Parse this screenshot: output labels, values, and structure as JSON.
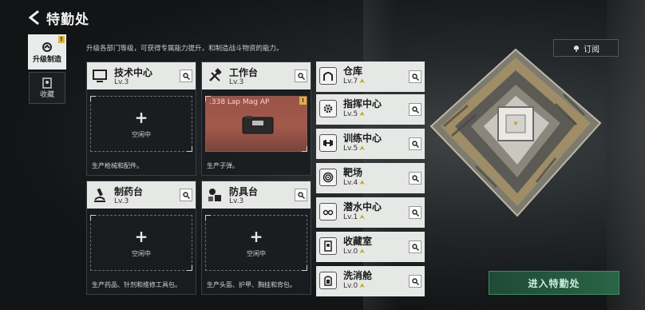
{
  "header": {
    "title": "特勤处",
    "description": "升级各部门等级，可获得专属能力提升，和制造战斗物资的能力。",
    "subscribe_label": "订阅"
  },
  "tabs": [
    {
      "label": "升级制造",
      "badge": "!"
    },
    {
      "label": "收藏"
    }
  ],
  "cards": [
    {
      "name": "技术中心",
      "level": "Lv.3",
      "slot_label": "空闲中",
      "footer": "生产枪械和配件。"
    },
    {
      "name": "工作台",
      "level": "Lv.3",
      "product_name": ".338 Lap Mag AP",
      "product_badge": "!",
      "footer": "生产子弹。"
    },
    {
      "name": "制药台",
      "level": "Lv.3",
      "slot_label": "空闲中",
      "footer": "生产药品、针剂和维修工具包。"
    },
    {
      "name": "防具台",
      "level": "Lv.3",
      "slot_label": "空闲中",
      "footer": "生产头盔、护甲、胸挂和背包。"
    }
  ],
  "facilities": [
    {
      "name": "仓库",
      "level": "Lv.7",
      "upgradable": true
    },
    {
      "name": "指挥中心",
      "level": "Lv.5",
      "upgradable": true
    },
    {
      "name": "训练中心",
      "level": "Lv.5",
      "upgradable": true
    },
    {
      "name": "靶场",
      "level": "Lv.4",
      "upgradable": true
    },
    {
      "name": "潜水中心",
      "level": "Lv.1",
      "upgradable": true
    },
    {
      "name": "收藏室",
      "level": "Lv.0",
      "upgradable": true
    },
    {
      "name": "洗消舱",
      "level": "Lv.0",
      "upgradable": true
    }
  ],
  "enter_button": "进入特勤处",
  "colors": {
    "accent_green": "#2a6446",
    "badge_yellow": "#d9b341",
    "product_bg": "#a25a4c"
  },
  "icons": [
    "back-arrow-icon",
    "bell-icon",
    "search-icon",
    "monitor-icon",
    "hammer-icon",
    "microscope-icon",
    "armor-icon",
    "warehouse-icon",
    "gear-icon",
    "dumbbell-icon",
    "target-icon",
    "diving-icon",
    "collection-icon",
    "decontamination-icon"
  ]
}
